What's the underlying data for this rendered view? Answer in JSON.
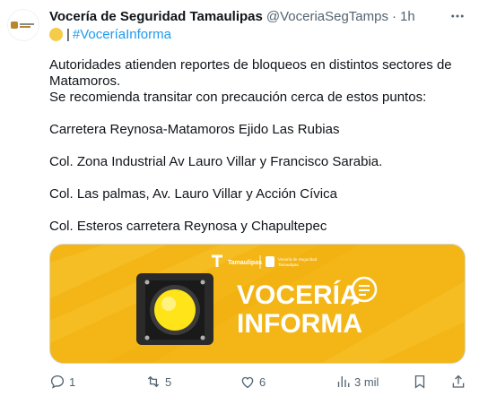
{
  "tweet": {
    "display_name": "Vocería de Seguridad Tamaulipas",
    "handle": "@VoceriaSegTamps",
    "separator": "·",
    "time": "1h",
    "tagline_bar": "|",
    "hashtag": "#VoceríaInforma",
    "body": {
      "line1": "Autoridades atienden reportes de bloqueos en distintos sectores de",
      "line2": "Matamoros.",
      "line3": "Se recomienda transitar con precaución cerca de estos puntos:",
      "point1": "Carretera  Reynosa-Matamoros Ejido Las Rubias",
      "point2": "Col. Zona Industrial Av Lauro Villar y Francisco Sarabia.",
      "point3": "Col. Las palmas, Av. Lauro Villar  y Acción Cívica",
      "point4": "Col. Esteros  carretera Reynosa y Chapultepec"
    },
    "media": {
      "brand1": "Tamaulipas",
      "brand2_line1": "Vocería de Seguridad",
      "brand2_line2": "Tamaulipas",
      "headline1": "VOCERÍA",
      "headline2": "INFORMA",
      "background_color": "#f4b617"
    },
    "actions": {
      "replies": "1",
      "reposts": "5",
      "likes": "6",
      "views": "3 mil"
    },
    "colors": {
      "link": "#1d9bf0",
      "secondary_text": "#536471"
    }
  }
}
